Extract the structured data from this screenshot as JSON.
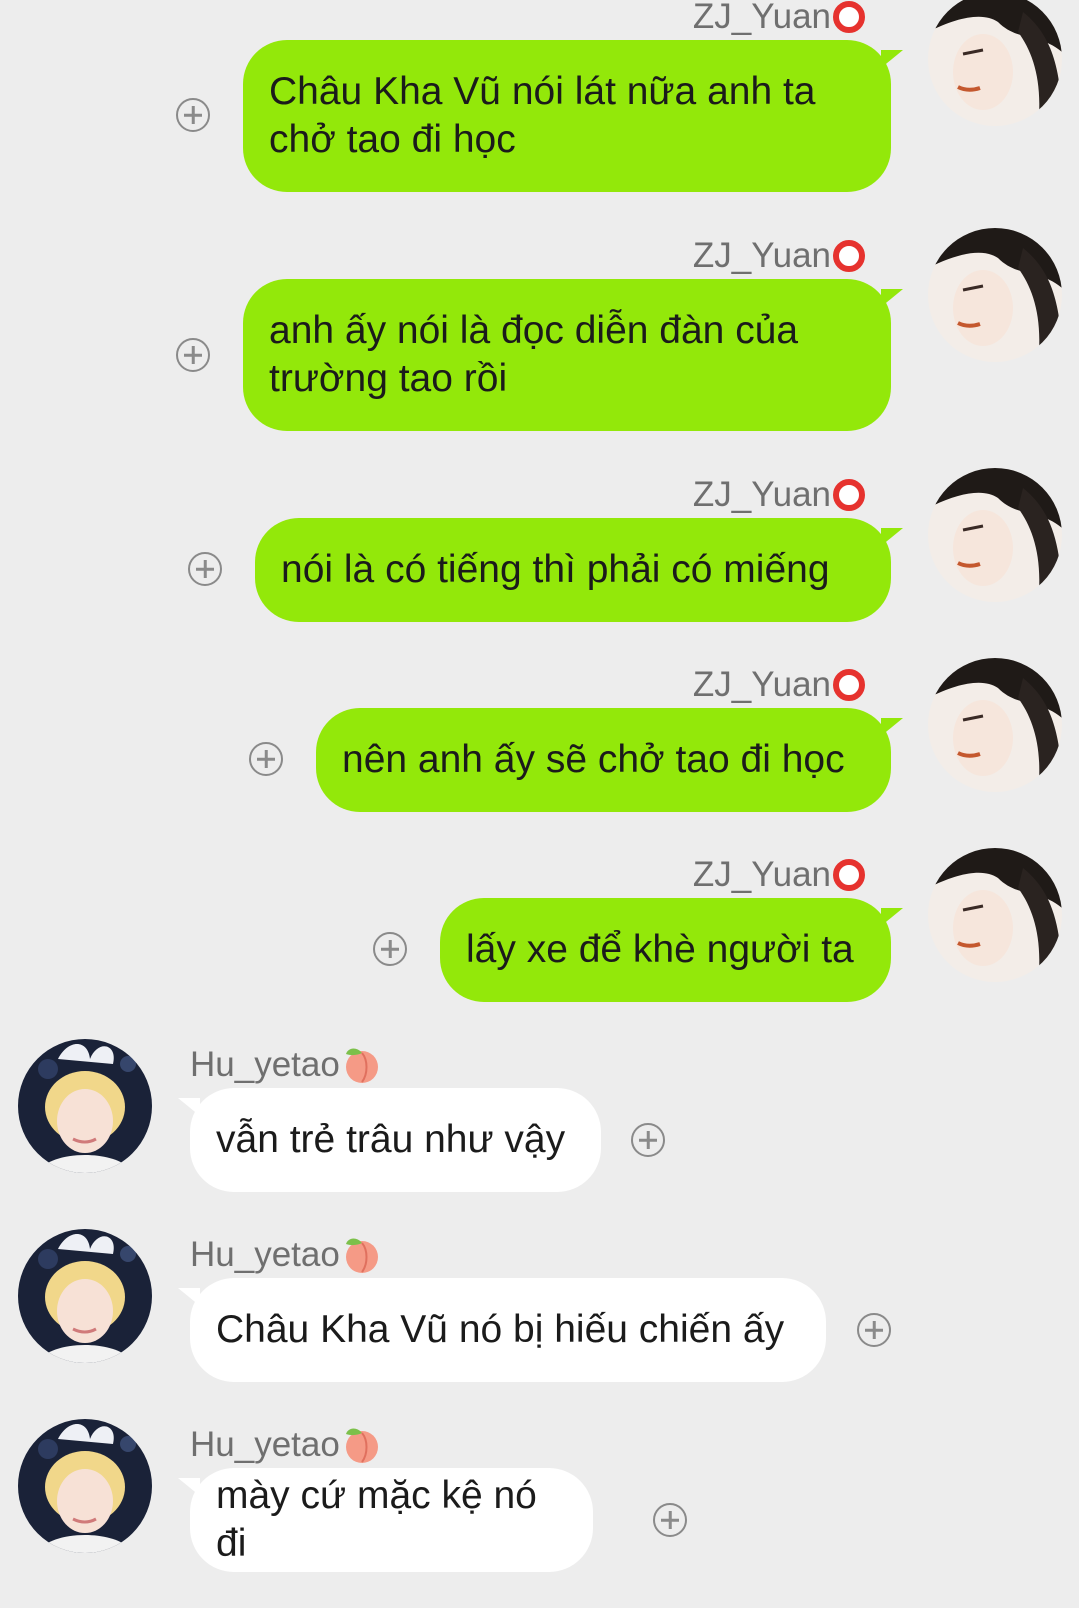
{
  "me": {
    "name": "ZJ_Yuan",
    "name_emoji": "ring-icon",
    "bubble_color": "#93e80a"
  },
  "them": {
    "name": "Hu_yetao",
    "name_emoji": "peach-icon",
    "bubble_color": "#ffffff"
  },
  "messages": [
    {
      "sender": "ZJ_Yuan",
      "lines": [
        "Châu Kha Vũ nói lát nữa anh ta",
        "chở tao đi học"
      ]
    },
    {
      "sender": "ZJ_Yuan",
      "lines": [
        "anh ấy nói là đọc diễn đàn của",
        "trường tao rồi"
      ]
    },
    {
      "sender": "ZJ_Yuan",
      "lines": [
        "nói là có tiếng thì phải có miếng"
      ]
    },
    {
      "sender": "ZJ_Yuan",
      "lines": [
        "nên anh ấy sẽ chở tao đi học"
      ]
    },
    {
      "sender": "ZJ_Yuan",
      "lines": [
        "lấy xe để khè người ta"
      ]
    },
    {
      "sender": "Hu_yetao",
      "lines": [
        "vẫn trẻ trâu như vậy"
      ]
    },
    {
      "sender": "Hu_yetao",
      "lines": [
        "Châu Kha Vũ nó bị hiếu chiến ấy"
      ]
    },
    {
      "sender": "Hu_yetao",
      "lines": [
        "mày cứ mặc kệ nó đi"
      ]
    }
  ]
}
